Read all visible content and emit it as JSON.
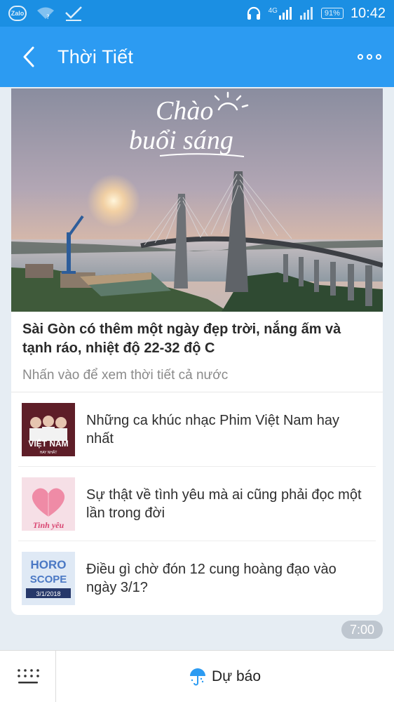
{
  "status": {
    "zalo": "Zalo",
    "signal_label": "4G",
    "battery": "91%",
    "time": "10:42"
  },
  "header": {
    "title": "Thời Tiết"
  },
  "hero": {
    "greeting_line1": "Chào",
    "greeting_line2": "buổi sáng",
    "title": "Sài Gòn có thêm một ngày đẹp trời, nắng ấm và tạnh ráo, nhiệt độ 22-32 độ C",
    "subtitle": "Nhấn vào để xem thời tiết cả nước"
  },
  "articles": [
    {
      "title": "Những ca khúc nhạc Phim Việt Nam hay nhất",
      "thumb_text": "VIỆT NAM",
      "thumb_sub": "HAY NHẤT",
      "icon": "music-thumbnail"
    },
    {
      "title": "Sự thật về tình yêu mà ai cũng phải đọc một lần trong đời",
      "thumb_text": "Tình yêu",
      "icon": "heart-thumbnail"
    },
    {
      "title": "Điều gì chờ đón 12 cung hoàng đạo vào ngày 3/1?",
      "thumb_text1": "HORO",
      "thumb_text2": "SCOPE",
      "thumb_date": "3/1/2018",
      "icon": "horoscope-thumbnail"
    }
  ],
  "message_time": "7:00",
  "bottom": {
    "forecast_label": "Dự báo"
  },
  "colors": {
    "status_bar": "#1b8fe3",
    "header": "#2c9bf2",
    "background": "#e6edf3"
  }
}
